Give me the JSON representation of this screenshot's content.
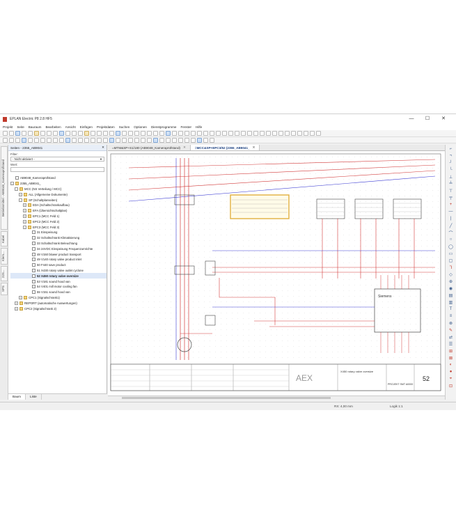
{
  "app": {
    "title": "EPLAN Electric P8 2.8 HF5"
  },
  "menu": [
    "Projekt",
    "Seite",
    "Bauraum",
    "Bearbeiten",
    "Ansicht",
    "Einfügen",
    "Projektdaten",
    "Suchen",
    "Optionen",
    "Dienstprogramme",
    "Fenster",
    "Hilfe"
  ],
  "side_tabs": [
    "Betriebsmittel - AB9048_Kameraprüfstand",
    "Kabel",
    "Klem...",
    "22S...",
    "SPS"
  ],
  "panel": {
    "title": "Seiten - 2355_AB9041",
    "filter_label": "Filter:",
    "filter_value": "- Nicht aktiviert -",
    "value_label": "Wert:",
    "tree": [
      {
        "label": "AB9048_Kameraprüfstand",
        "expander": "",
        "icon": "page",
        "level": 0
      },
      {
        "label": "2355_AB9041_",
        "expander": "-",
        "icon": "folder",
        "level": 0
      },
      {
        "label": "MCC (NS Verteilung / MCC)",
        "expander": "-",
        "icon": "folder",
        "level": 1
      },
      {
        "label": "ALL (Allgemeine Dokumente)",
        "expander": "+",
        "icon": "folder",
        "level": 2
      },
      {
        "label": "SP (Schaltplanseiten)",
        "expander": "-",
        "icon": "folder",
        "level": 2
      },
      {
        "label": "EDA (Schaltschrankaufbau)",
        "expander": "+",
        "icon": "folder",
        "level": 3
      },
      {
        "label": "EFA (Übersichtschaltplan)",
        "expander": "+",
        "icon": "folder",
        "level": 3
      },
      {
        "label": "EPC1 (MCC Feld 1)",
        "expander": "+",
        "icon": "folder",
        "level": 3
      },
      {
        "label": "EPC2 (MCC Feld 2)",
        "expander": "+",
        "icon": "folder",
        "level": 3
      },
      {
        "label": "EPC3 (MCC Feld 3)",
        "expander": "-",
        "icon": "folder",
        "level": 3
      },
      {
        "label": "31 Einspeisung",
        "expander": "",
        "icon": "page",
        "level": 4
      },
      {
        "label": "32 Schaltschrank Klimatisierung",
        "expander": "",
        "icon": "page",
        "level": 4
      },
      {
        "label": "33 Schaltschrank Beleuchtung",
        "expander": "",
        "icon": "page",
        "level": 4
      },
      {
        "label": "34 24VDC Einspeisung Frequenzumrichte",
        "expander": "",
        "icon": "page",
        "level": 4
      },
      {
        "label": "48 V150 blower product transport",
        "expander": "",
        "icon": "page",
        "level": 4
      },
      {
        "label": "49 V140 rotary valve product inlet",
        "expander": "",
        "icon": "page",
        "level": 4
      },
      {
        "label": "50 F440 save product",
        "expander": "",
        "icon": "page",
        "level": 4
      },
      {
        "label": "51 X430 rotary valve outlet cyclone",
        "expander": "",
        "icon": "page",
        "level": 4
      },
      {
        "label": "52 X450 rotary valve oversize",
        "expander": "",
        "icon": "page",
        "level": 4,
        "selected": true
      },
      {
        "label": "53 V181 sound hood van",
        "expander": "",
        "icon": "page",
        "level": 4
      },
      {
        "label": "54 V401 mill motor cooling fan",
        "expander": "",
        "icon": "page",
        "level": 4
      },
      {
        "label": "55 V151 sound hood van",
        "expander": "",
        "icon": "page",
        "level": 4
      },
      {
        "label": "CPC1 (Signalschrank1)",
        "expander": "+",
        "icon": "folder",
        "level": 2
      },
      {
        "label": "REPORT (automatische Auswertungen)",
        "expander": "+",
        "icon": "folder",
        "level": 1
      },
      {
        "label": "CPC2 (Signalschrank 2)",
        "expander": "+",
        "icon": "folder",
        "level": 1
      }
    ],
    "bottom_tabs": [
      "Baum",
      "Liste"
    ]
  },
  "doc_tabs": [
    {
      "label": "=MTM&SP+S1/180 (AB9048_Kameraprüfstand)",
      "active": false
    },
    {
      "label": "=MCC&SP+EPC3/52 (2355_AB9041_",
      "active": true
    }
  ],
  "schematic": {
    "siemens_label": "Siemens",
    "titleblock_page": "52",
    "titleblock_brand": "AEX",
    "titleblock_desc": "X450 rotary valve oversize",
    "titleblock_client": "PROJEKT SMT A0000",
    "colors": {
      "wire_red": "#d23a3a",
      "wire_blue": "#3a3ad2",
      "highlight": "#e0b040"
    }
  },
  "status": {
    "coords": "RX: 4,00 mm",
    "logic": "Logik 1:1"
  },
  "window_controls": [
    "—",
    "☐",
    "✕"
  ]
}
